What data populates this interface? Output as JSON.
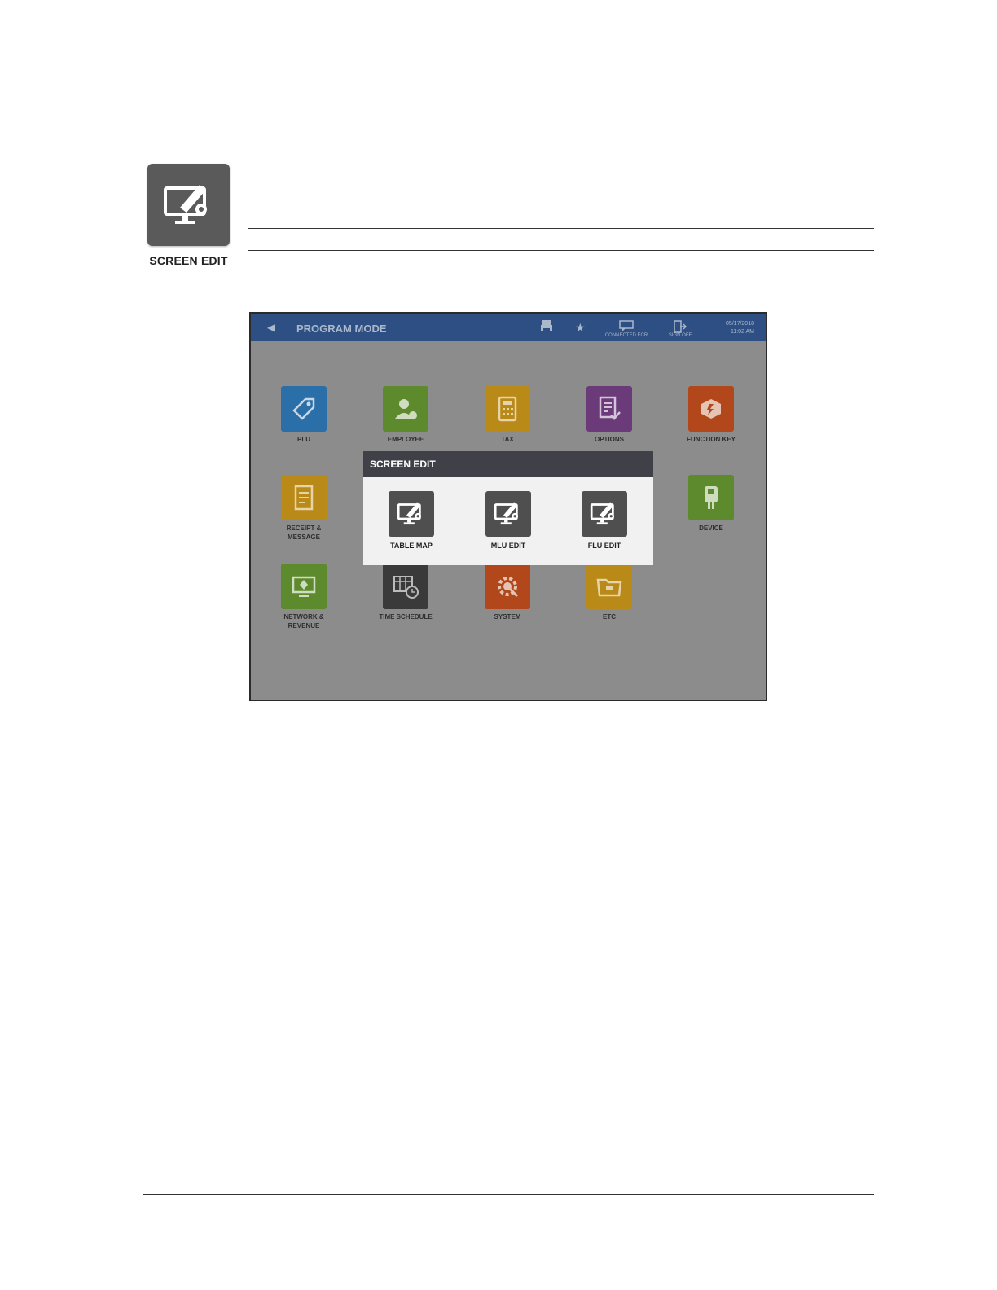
{
  "section": {
    "label": "SCREEN EDIT",
    "icon": "screen-edit-icon"
  },
  "screenshot": {
    "topbar": {
      "back_icon": "back-arrow-icon",
      "title": "PROGRAM MODE",
      "connected_label": "CONNECTED ECR",
      "signoff_label": "SIGN OFF",
      "date": "05/17/2018",
      "time": "11:02 AM"
    },
    "tiles": [
      {
        "label": "PLU",
        "icon": "tag-icon",
        "color": "#2a6fa8"
      },
      {
        "label": "EMPLOYEE",
        "icon": "employee-icon",
        "color": "#5e8a2e"
      },
      {
        "label": "TAX",
        "icon": "calculator-icon",
        "color": "#b98a18"
      },
      {
        "label": "OPTIONS",
        "icon": "checklist-icon",
        "color": "#6a3b78"
      },
      {
        "label": "FUNCTION KEY",
        "icon": "function-key-icon",
        "color": "#b2471c"
      },
      {
        "label": "RECEIPT &\nMESSAGE",
        "icon": "receipt-icon",
        "color": "#b98a18"
      },
      {
        "label": "DEVICE",
        "icon": "device-icon",
        "color": "#5e8a2e"
      },
      {
        "label": "NETWORK &\nREVENUE",
        "icon": "network-icon",
        "color": "#5e8a2e"
      },
      {
        "label": "TIME SCHEDULE",
        "icon": "calendar-clock-icon",
        "color": "#3a3a3a"
      },
      {
        "label": "SYSTEM",
        "icon": "gear-wrench-icon",
        "color": "#b2471c"
      },
      {
        "label": "ETC",
        "icon": "folder-icon",
        "color": "#b98a18"
      }
    ],
    "modal": {
      "title": "SCREEN EDIT",
      "options": [
        {
          "label": "TABLE MAP",
          "icon": "screen-edit-icon"
        },
        {
          "label": "MLU EDIT",
          "icon": "screen-edit-icon"
        },
        {
          "label": "FLU EDIT",
          "icon": "screen-edit-icon"
        }
      ]
    }
  }
}
